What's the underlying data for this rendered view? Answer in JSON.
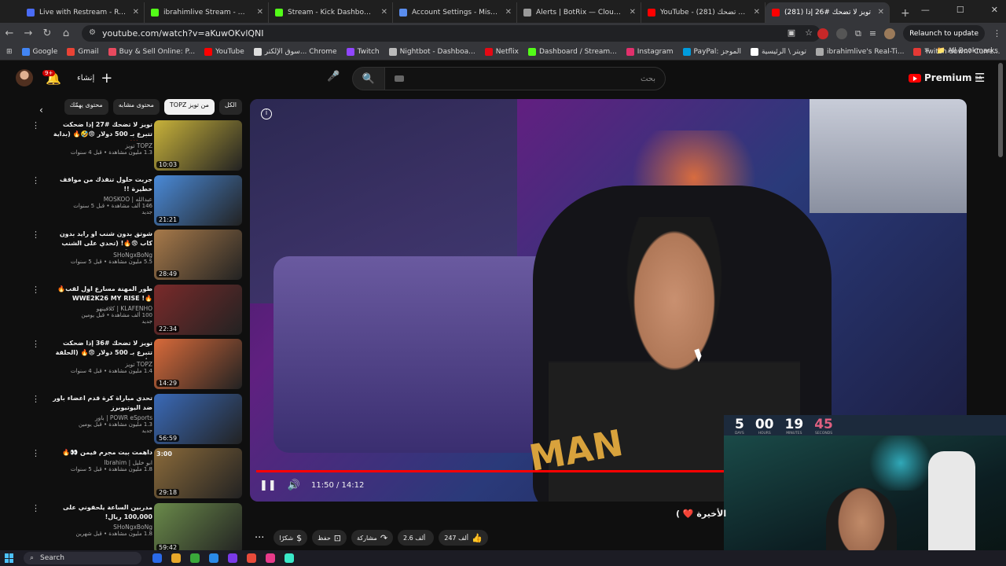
{
  "browser": {
    "tabs": [
      {
        "title": "Live with Restream - Restream",
        "color": "#4a6cf7",
        "active": false
      },
      {
        "title": "ibrahimlive Stream - Watch Live",
        "color": "#53fc18",
        "active": false
      },
      {
        "title": "Stream - Kick Dashboard",
        "color": "#53fc18",
        "active": false
      },
      {
        "title": "Account Settings - MissXss AI",
        "color": "#5a8dee",
        "active": false
      },
      {
        "title": "Alerts | BotRix — Cloud Stream",
        "color": "#9a9a9a",
        "active": false
      },
      {
        "title": "YouTube - تويز لا تضحك (281)",
        "color": "#ff0000",
        "active": false
      },
      {
        "title": "(281) تويز لا تضحك #26 إذا",
        "color": "#ff0000",
        "active": true
      }
    ],
    "new_tab_glyph": "+",
    "url": "youtube.com/watch?v=aKuwOKvlQNI",
    "relaunch_label": "Relaunch to update",
    "bookmarks": [
      {
        "label": "Google",
        "color": "#4285f4"
      },
      {
        "label": "Gmail",
        "color": "#ea4335"
      },
      {
        "label": "Buy & Sell Online: P...",
        "color": "#e84a5f"
      },
      {
        "label": "YouTube",
        "color": "#ff0000"
      },
      {
        "label": "سوق الإلكتر... Chrome",
        "color": "#ddd"
      },
      {
        "label": "Twitch",
        "color": "#9146ff"
      },
      {
        "label": "Nightbot - Dashboa...",
        "color": "#bbbbbb"
      },
      {
        "label": "Netflix",
        "color": "#e50914"
      },
      {
        "label": "Dashboard / Stream...",
        "color": "#53fc18"
      },
      {
        "label": "Instagram",
        "color": "#e1306c"
      },
      {
        "label": "PayPal: الموجز",
        "color": "#009cde"
      },
      {
        "label": "تويتر \\ الرئيسية",
        "color": "#ffffff"
      },
      {
        "label": "ibrahimlive's Real-Ti...",
        "color": "#aaaaaa"
      },
      {
        "label": "Twitch down? Curre...",
        "color": "#e53935"
      }
    ],
    "all_bookmarks_label": "All Bookmarks"
  },
  "youtube": {
    "notif_count": "9+",
    "create_label": "إنشاء",
    "search_placeholder": "بحث",
    "premium_label": "Premium",
    "premium_region": "SA",
    "chips": [
      {
        "label": "الكل",
        "selected": false
      },
      {
        "label": "من تويز TOPZ",
        "selected": true
      },
      {
        "label": "محتوى مشابه",
        "selected": false
      },
      {
        "label": "محتوى يهمّك",
        "selected": false
      }
    ],
    "recommendations": [
      {
        "title": "تويز لا تضحك #27 إذا ضحكت تتبرع بـ 500 دولار 😨🤣🔥 (بداية قوية💥)",
        "channel": "TOPZ تويز",
        "meta": "1.3 مليون مشاهدة • قبل 4 سنوات",
        "duration": "10:03",
        "thumb": "#c8b23a"
      },
      {
        "title": "جربت حلول تنقذك من مواقف خطيرة !!",
        "channel": "عبدالله | MOSKOO",
        "meta": "146 ألف مشاهدة • قبل 5 سنوات",
        "extra": "جديد",
        "duration": "21:21",
        "thumb": "#4a8ad8"
      },
      {
        "title": "شوتق بدون شنب او رايد بدون كاب 😨🔥! (تحدي على الشنب والكاب 😨!!)",
        "channel": "SHoNgxBoNg",
        "meta": "5.5 مليون مشاهدة • قبل 5 سنوات",
        "duration": "28:49",
        "thumb": "#a87a4a"
      },
      {
        "title": "طور المهنة مسارع اول لقب🔥🔥! WWE2K26 MY RISE",
        "channel": "KLAFENHO | كلافينهو",
        "meta": "100 ألف مشاهدة • قبل يومين",
        "extra": "جديد",
        "duration": "22:34",
        "thumb": "#7a2a2a"
      },
      {
        "title": "تويز لا تضحك #36 إذا ضحكت تتبرع بـ 500 دولار 😨🔥 (الحلقة الأخيرة !)",
        "channel": "TOPZ تويز",
        "meta": "1.4 مليون مشاهدة • قبل 4 سنوات",
        "duration": "14:29",
        "thumb": "#d86a3a"
      },
      {
        "title": "تحدي مباراة كرة قدم اعضاء باور ضد اليوتيوبرز",
        "channel": "POWR eSports | باور",
        "meta": "1.3 مليون مشاهدة • قبل يومين",
        "extra": "جديد",
        "duration": "56:59",
        "thumb": "#3a6ab8"
      },
      {
        "title": "داهمت بيت مجرم فيمن 👀🔥",
        "channel": "ابو خليل | Ibrahim",
        "meta": "1.8 مليون مشاهدة • قبل 5 سنوات",
        "duration": "29:18",
        "thumb": "#8a6a3a",
        "badge": "3:00"
      },
      {
        "title": "مدربين الساعة يلحقوني على 100,000 ريال!",
        "channel": "SHoNgxBoNg",
        "meta": "1.8 مليون مشاهدة • قبل شهرين",
        "duration": "59:42",
        "thumb": "#6a8a4a"
      }
    ],
    "player": {
      "time": "11:50 / 14:12",
      "progress": 0.833,
      "shirt_text": "MAN"
    },
    "video_title_tail": "الأخيرة ❤️ )",
    "actions": [
      {
        "label": "247 ألف",
        "icon": "like-icon",
        "glyph": "👍"
      },
      {
        "label": "2.6 ألف",
        "icon": "dislike-icon",
        "glyph": ""
      },
      {
        "label": "مشاركة",
        "icon": "share-icon",
        "glyph": "↷"
      },
      {
        "label": "حفظ",
        "icon": "save-icon",
        "glyph": "⊡"
      },
      {
        "label": "شكرًا",
        "icon": "thanks-icon",
        "glyph": "$"
      }
    ]
  },
  "countdown": [
    {
      "value": "5",
      "label": "DAYS",
      "color": "#ffffff"
    },
    {
      "value": "00",
      "label": "HOURS",
      "color": "#ffffff"
    },
    {
      "value": "19",
      "label": "MINUTES",
      "color": "#ffffff"
    },
    {
      "value": "45",
      "label": "SECONDS",
      "color": "#e06080"
    }
  ],
  "taskbar": {
    "search_label": "Search",
    "apps": [
      "#2a6ae8",
      "#e8a82a",
      "#3aa83a",
      "#2a8ae8",
      "#7a3ae8",
      "#e84a3a",
      "#e83a8a",
      "#3ae8c8"
    ]
  }
}
